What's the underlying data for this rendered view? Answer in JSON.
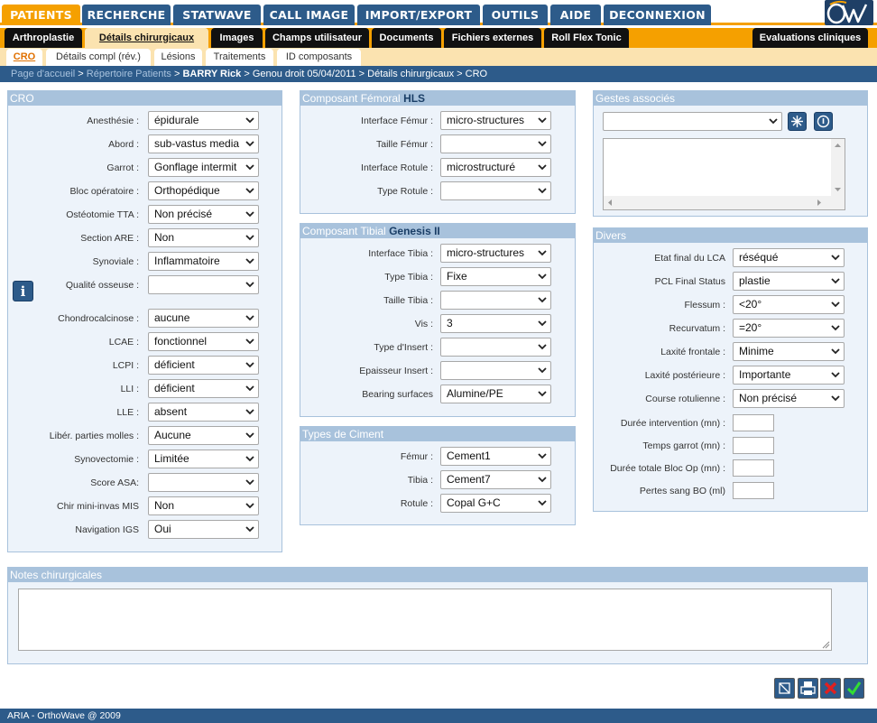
{
  "top_tabs": [
    "PATIENTS",
    "RECHERCHE",
    "STATWAVE",
    "CALL IMAGE",
    "IMPORT/EXPORT",
    "OUTILS",
    "AIDE",
    "DECONNEXION"
  ],
  "sub_tabs": [
    "Arthroplastie",
    "Détails chirurgicaux",
    "Images",
    "Champs utilisateur",
    "Documents",
    "Fichiers externes",
    "Roll Flex Tonic"
  ],
  "sub_tab_right": "Evaluations cliniques",
  "third_tabs": [
    "CRO",
    "Détails compl (rév.)",
    "Lésions",
    "Traitements",
    "ID composants"
  ],
  "breadcrumb": {
    "home": "Page d'accueil",
    "sep1": " > ",
    "patients": "Répertoire Patients",
    "sep2": " > ",
    "patient": "BARRY Rick",
    "rest": " > Genou droit 05/04/2011 > Détails chirurgicaux > CRO"
  },
  "cro": {
    "title": "CRO",
    "fields": [
      {
        "label": "Anesthésie :",
        "value": "épidurale"
      },
      {
        "label": "Abord :",
        "value": "sub-vastus media"
      },
      {
        "label": "Garrot :",
        "value": "Gonflage intermit"
      },
      {
        "label": "Bloc opératoire :",
        "value": "Orthopédique"
      },
      {
        "label": "Ostéotomie TTA :",
        "value": "Non précisé"
      },
      {
        "label": "Section ARE :",
        "value": "Non"
      },
      {
        "label": "Synoviale :",
        "value": "Inflammatoire"
      },
      {
        "label": "Qualité osseuse :",
        "value": ""
      },
      {
        "label": "Chondrocalcinose :",
        "value": "aucune"
      },
      {
        "label": "LCAE :",
        "value": "fonctionnel"
      },
      {
        "label": "LCPI :",
        "value": "déficient"
      },
      {
        "label": "LLI :",
        "value": "déficient"
      },
      {
        "label": "LLE :",
        "value": "absent"
      },
      {
        "label": "Libér. parties molles :",
        "value": "Aucune"
      },
      {
        "label": "Synovectomie :",
        "value": "Limitée"
      },
      {
        "label": "Score ASA:",
        "value": ""
      },
      {
        "label": "Chir mini-invas MIS",
        "value": "Non"
      },
      {
        "label": "Navigation IGS",
        "value": "Oui"
      }
    ]
  },
  "femoral": {
    "title": "Composant Fémoral",
    "brand": "HLS",
    "fields": [
      {
        "label": "Interface Fémur :",
        "value": "micro-structures"
      },
      {
        "label": "Taille Fémur :",
        "value": ""
      },
      {
        "label": "Interface Rotule :",
        "value": "microstructuré"
      },
      {
        "label": "Type Rotule :",
        "value": ""
      }
    ]
  },
  "tibial": {
    "title": "Composant Tibial",
    "brand": "Genesis II",
    "fields": [
      {
        "label": "Interface Tibia :",
        "value": "micro-structures"
      },
      {
        "label": "Type Tibia :",
        "value": "Fixe"
      },
      {
        "label": "Taille Tibia :",
        "value": ""
      },
      {
        "label": "Vis :",
        "value": "3"
      },
      {
        "label": "Type d'Insert :",
        "value": ""
      },
      {
        "label": "Epaisseur Insert :",
        "value": ""
      },
      {
        "label": "Bearing surfaces",
        "value": "Alumine/PE"
      }
    ]
  },
  "ciment": {
    "title": "Types de Ciment",
    "fields": [
      {
        "label": "Fémur :",
        "value": "Cement1"
      },
      {
        "label": "Tibia :",
        "value": "Cement7"
      },
      {
        "label": "Rotule :",
        "value": "Copal G+C"
      }
    ]
  },
  "gestes": {
    "title": "Gestes associés",
    "select_value": ""
  },
  "divers": {
    "title": "Divers",
    "selects": [
      {
        "label": "Etat final du LCA",
        "value": "réséqué"
      },
      {
        "label": "PCL Final Status",
        "value": "plastie"
      },
      {
        "label": "Flessum :",
        "value": "<20°"
      },
      {
        "label": "Recurvatum :",
        "value": "=20°"
      },
      {
        "label": "Laxité frontale :",
        "value": "Minime"
      },
      {
        "label": "Laxité postérieure :",
        "value": "Importante"
      },
      {
        "label": "Course rotulienne :",
        "value": "Non précisé"
      }
    ],
    "inputs": [
      {
        "label": "Durée intervention (mn) :",
        "value": ""
      },
      {
        "label": "Temps garrot (mn) :",
        "value": ""
      },
      {
        "label": "Durée totale Bloc Op (mn) :",
        "value": ""
      },
      {
        "label": "Pertes sang BO (ml)",
        "value": ""
      }
    ]
  },
  "notes": {
    "title": "Notes chirurgicales",
    "value": ""
  },
  "footer": "ARIA - OrthoWave @ 2009",
  "colors": {
    "accent": "#f5a000",
    "nav": "#2d5b8a",
    "panel_header": "#a8c2dc",
    "panel_bg": "#edf3fa"
  }
}
